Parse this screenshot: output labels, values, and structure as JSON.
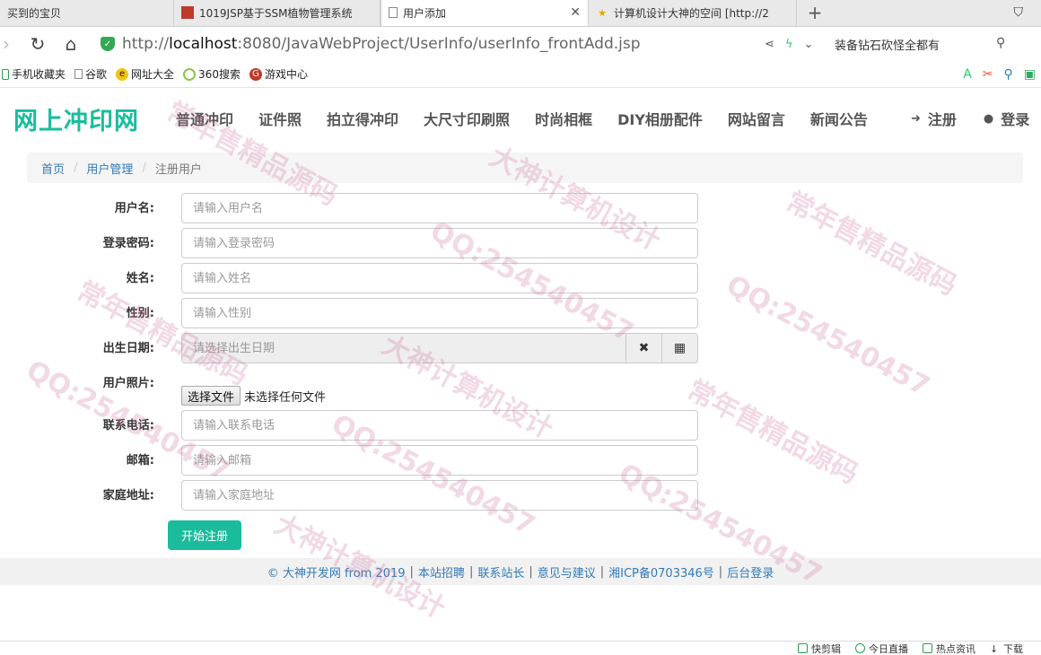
{
  "browser": {
    "tabs": [
      {
        "title": "买到的宝贝",
        "active": false
      },
      {
        "title": "1019JSP基于SSM植物管理系统",
        "active": false
      },
      {
        "title": "用户添加",
        "active": true
      },
      {
        "title": "计算机设计大神的空间 [http://2",
        "active": false
      }
    ],
    "url_scheme": "http://",
    "url_host": "localhost",
    "url_path": ":8080/JavaWebProject/UserInfo/userInfo_frontAdd.jsp",
    "search_hint": "装备钻石砍怪全都有",
    "bookmarks": [
      "手机收藏夹",
      "谷歌",
      "网址大全",
      "360搜索",
      "游戏中心"
    ]
  },
  "site": {
    "brand": "网上冲印网",
    "menu": [
      "普通冲印",
      "证件照",
      "拍立得冲印",
      "大尺寸印刷照",
      "时尚相框",
      "DIY相册配件",
      "网站留言",
      "新闻公告"
    ],
    "register": "注册",
    "login": "登录"
  },
  "breadcrumb": {
    "home": "首页",
    "section": "用户管理",
    "current": "注册用户"
  },
  "form": {
    "username": {
      "label": "用户名:",
      "placeholder": "请输入用户名"
    },
    "password": {
      "label": "登录密码:",
      "placeholder": "请输入登录密码"
    },
    "name": {
      "label": "姓名:",
      "placeholder": "请输入姓名"
    },
    "gender": {
      "label": "性别:",
      "placeholder": "请输入性别"
    },
    "birthday": {
      "label": "出生日期:",
      "placeholder": "请选择出生日期"
    },
    "photo": {
      "label": "用户照片:",
      "button": "选择文件",
      "status": "未选择任何文件"
    },
    "phone": {
      "label": "联系电话:",
      "placeholder": "请输入联系电话"
    },
    "email": {
      "label": "邮箱:",
      "placeholder": "请输入邮箱"
    },
    "address": {
      "label": "家庭地址:",
      "placeholder": "请输入家庭地址"
    },
    "submit": "开始注册"
  },
  "footer": {
    "copyright": "© 大神开发网 from 2019",
    "links": [
      "本站招聘",
      "联系站长",
      "意见与建议",
      "湘ICP备0703346号",
      "后台登录"
    ]
  },
  "statusbar": [
    "快剪辑",
    "今日直播",
    "热点资讯",
    "下载"
  ],
  "watermarks": [
    "QQ:254540457",
    "大神计算机设计",
    "常年售精品源码"
  ]
}
